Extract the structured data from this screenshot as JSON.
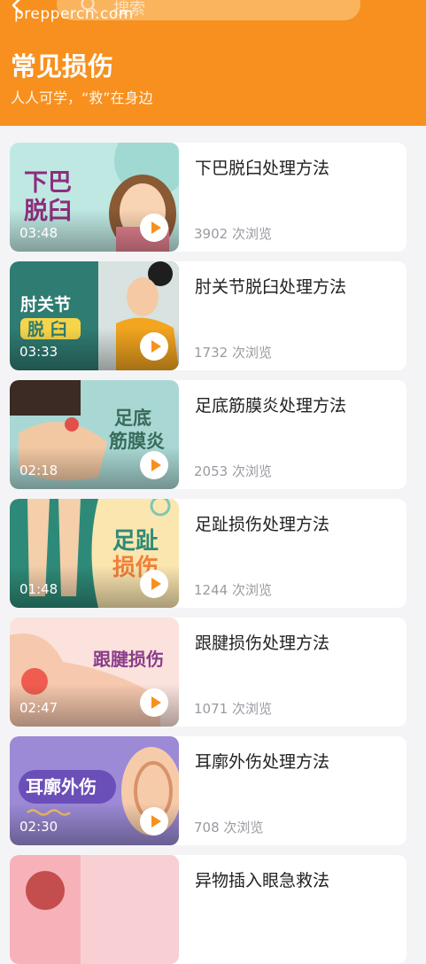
{
  "header": {
    "back_icon": "chevron-left-icon",
    "search_icon": "search-icon",
    "search_placeholder": "搜索",
    "watermark": "prepperc‌n.com",
    "title": "常见损伤",
    "subtitle": "人人可学，“救”在身边",
    "bg_color": "#f7901e"
  },
  "videos": [
    {
      "title": "下巴脱臼处理方法",
      "views": "3902 次浏览",
      "duration": "03:48",
      "thumb_text": [
        "下巴",
        "脱臼"
      ]
    },
    {
      "title": "肘关节脱臼处理方法",
      "views": "1732 次浏览",
      "duration": "03:33",
      "thumb_text": [
        "肘关节",
        "脱 臼"
      ]
    },
    {
      "title": "足底筋膜炎处理方法",
      "views": "2053 次浏览",
      "duration": "02:18",
      "thumb_text": [
        "足底",
        "筋膜炎"
      ]
    },
    {
      "title": "足趾损伤处理方法",
      "views": "1244 次浏览",
      "duration": "01:48",
      "thumb_text": [
        "足趾",
        "损伤"
      ]
    },
    {
      "title": "跟腱损伤处理方法",
      "views": "1071 次浏览",
      "duration": "02:47",
      "thumb_text": [
        "跟腱损伤"
      ]
    },
    {
      "title": "耳廓外伤处理方法",
      "views": "708 次浏览",
      "duration": "02:30",
      "thumb_text": [
        "耳廓外伤"
      ]
    },
    {
      "title": "异物插入眼急救法",
      "views": "",
      "duration": "",
      "thumb_text": []
    }
  ]
}
